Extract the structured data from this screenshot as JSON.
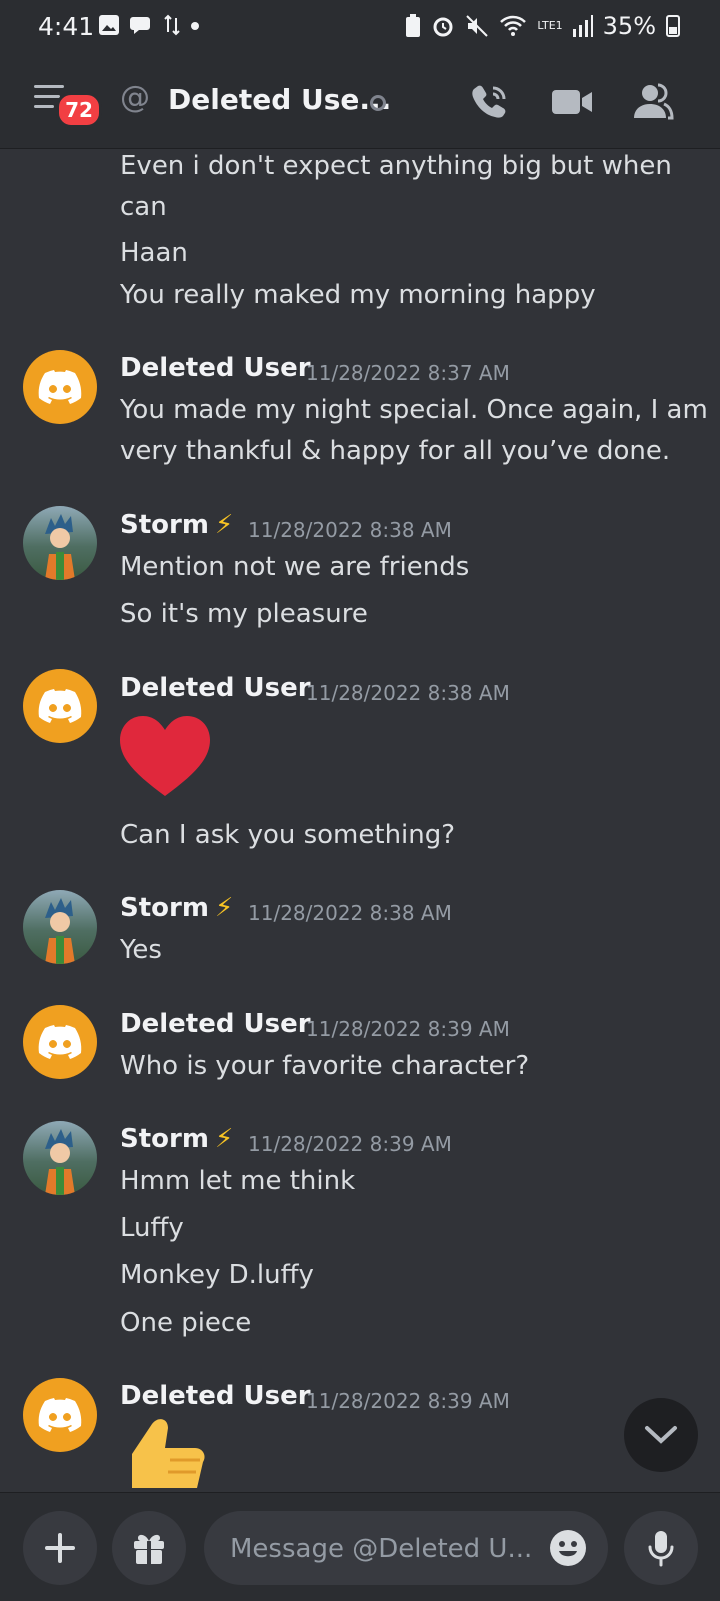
{
  "status_bar": {
    "time": "4:41",
    "battery": "35%",
    "network_label": "LTE1"
  },
  "header": {
    "badge_count": "72",
    "title": "Deleted Use...",
    "icons": [
      "menu-icon",
      "at-icon",
      "phone-call-icon",
      "video-camera-icon",
      "member-list-icon"
    ]
  },
  "messages": {
    "continuation": [
      "Even i don't expect anything big but when",
      "can",
      "Haan",
      "You really maked my morning happy"
    ],
    "groups": [
      {
        "author": "Deleted User",
        "timestamp": "11/28/2022 8:37 AM",
        "lines": [
          "You made my night special. Once again, I am",
          "very thankful & happy for all you’ve done."
        ]
      },
      {
        "author": "Storm",
        "author_emoji": "⚡",
        "timestamp": "11/28/2022 8:38 AM",
        "lines": [
          "Mention not we are friends",
          "So it's my pleasure"
        ]
      },
      {
        "author": "Deleted User",
        "timestamp": "11/28/2022 8:38 AM",
        "emoji": "heart",
        "lines": [
          "Can I ask you something?"
        ]
      },
      {
        "author": "Storm",
        "author_emoji": "⚡",
        "timestamp": "11/28/2022 8:38 AM",
        "lines": [
          "Yes"
        ]
      },
      {
        "author": "Deleted User",
        "timestamp": "11/28/2022 8:39 AM",
        "lines": [
          "Who is your favorite character?"
        ]
      },
      {
        "author": "Storm",
        "author_emoji": "⚡",
        "timestamp": "11/28/2022 8:39 AM",
        "lines": [
          "Hmm let me think",
          "Luffy",
          "Monkey D.luffy",
          "One piece"
        ]
      },
      {
        "author": "Deleted User",
        "timestamp": "11/28/2022 8:39 AM",
        "emoji": "thumbs-up"
      }
    ]
  },
  "composer": {
    "placeholder": "Message @Deleted U..."
  },
  "colors": {
    "background": "#313338",
    "header": "#2b2d31",
    "badge": "#f23f43",
    "discord_avatar": "#f0a020",
    "heart": "#e0283c"
  }
}
